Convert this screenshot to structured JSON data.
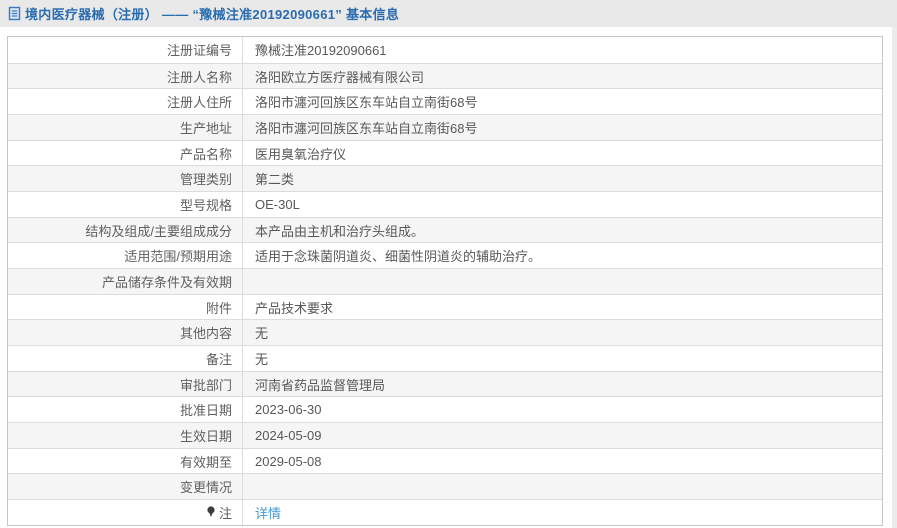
{
  "header": {
    "icon": "document-icon",
    "title": "境内医疗器械（注册） —— “豫械注准20192090661” 基本信息"
  },
  "table": {
    "rows": [
      {
        "label": "注册证编号",
        "value": "豫械注准20192090661"
      },
      {
        "label": "注册人名称",
        "value": "洛阳欧立方医疗器械有限公司"
      },
      {
        "label": "注册人住所",
        "value": "洛阳市瀍河回族区东车站自立南街68号"
      },
      {
        "label": "生产地址",
        "value": "洛阳市瀍河回族区东车站自立南街68号"
      },
      {
        "label": "产品名称",
        "value": "医用臭氧治疗仪"
      },
      {
        "label": "管理类别",
        "value": "第二类"
      },
      {
        "label": "型号规格",
        "value": "OE-30L"
      },
      {
        "label": "结构及组成/主要组成成分",
        "value": "本产品由主机和治疗头组成。"
      },
      {
        "label": "适用范围/预期用途",
        "value": "适用于念珠菌阴道炎、细菌性阴道炎的辅助治疗。"
      },
      {
        "label": "产品储存条件及有效期",
        "value": ""
      },
      {
        "label": "附件",
        "value": "产品技术要求"
      },
      {
        "label": "其他内容",
        "value": "无"
      },
      {
        "label": "备注",
        "value": "无"
      },
      {
        "label": "审批部门",
        "value": "河南省药品监督管理局"
      },
      {
        "label": "批准日期",
        "value": "2023-06-30"
      },
      {
        "label": "生效日期",
        "value": "2024-05-09"
      },
      {
        "label": "有效期至",
        "value": "2029-05-08"
      },
      {
        "label": "变更情况",
        "value": ""
      },
      {
        "label": "注",
        "value": "详情",
        "value_is_link": true,
        "label_icon": "pin-icon"
      }
    ]
  },
  "colors": {
    "topbar_bg": "#e9e9e9",
    "title_blue": "#2a6cb0",
    "link_blue": "#4498d8",
    "row_alt_bg": "#f5f5f5",
    "border_outer": "#c6c6c6",
    "border_inner": "#dcdcdc",
    "text": "#585858"
  }
}
